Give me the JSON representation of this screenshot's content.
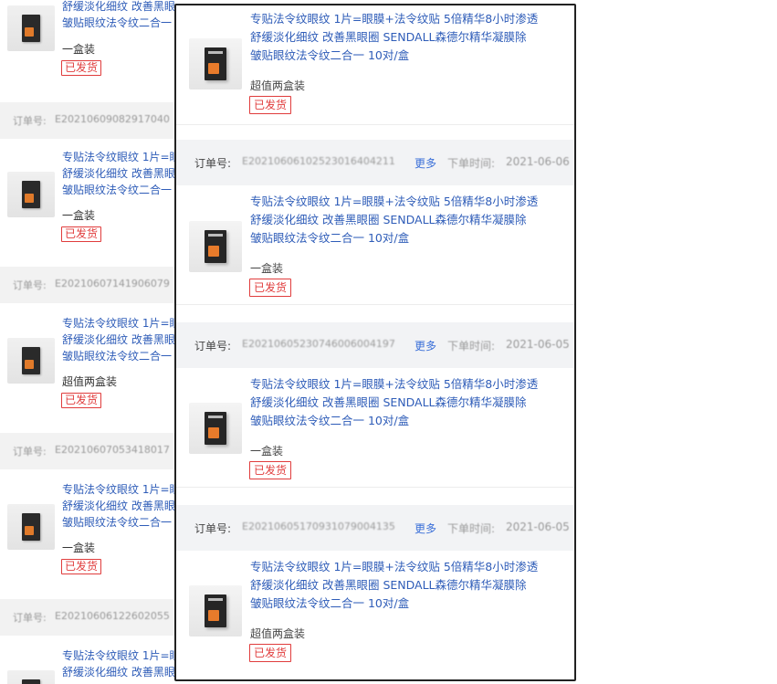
{
  "background_list": {
    "items": [
      {
        "title_lines": [
          "舒缓淡化细纹 改善黑眼",
          "皱贴眼纹法令纹二合一"
        ],
        "spec": "一盒装",
        "status": "已发货"
      },
      {
        "order_label": "订单号:",
        "order_no": "E20210609082917040"
      },
      {
        "title_lines": [
          "专贴法令纹眼纹 1片=眼",
          "舒缓淡化细纹 改善黑眼",
          "皱贴眼纹法令纹二合一"
        ],
        "spec": "一盒装",
        "status": "已发货"
      },
      {
        "order_label": "订单号:",
        "order_no": "E20210607141906079"
      },
      {
        "title_lines": [
          "专贴法令纹眼纹 1片=眼",
          "舒缓淡化细纹 改善黑眼",
          "皱贴眼纹法令纹二合一"
        ],
        "spec": "超值两盒装",
        "status": "已发货"
      },
      {
        "order_label": "订单号:",
        "order_no": "E20210607053418017"
      },
      {
        "title_lines": [
          "专贴法令纹眼纹 1片=眼",
          "舒缓淡化细纹 改善黑眼",
          "皱贴眼纹法令纹二合一"
        ],
        "spec": "一盒装",
        "status": "已发货"
      },
      {
        "order_label": "订单号:",
        "order_no": "E20210606122602055"
      },
      {
        "title_lines": [
          "专贴法令纹眼纹 1片=眼",
          "舒缓淡化细纹 改善黑眼"
        ]
      }
    ]
  },
  "panel": {
    "product_title_lines": [
      "专贴法令纹眼纹 1片=眼膜+法令纹贴 5倍精华8小时渗透",
      "舒缓淡化细纹 改善黑眼圈 SENDALL森德尔精华凝膜除",
      "皱贴眼纹法令纹二合一 10对/盒"
    ],
    "first_product": {
      "spec": "超值两盒装",
      "status": "已发货"
    },
    "orders": [
      {
        "label": "订单号:",
        "number": "E20210606102523016404211",
        "more": "更多",
        "time_label": "下单时间:",
        "time": "2021-06-06",
        "spec": "一盒装",
        "status": "已发货"
      },
      {
        "label": "订单号:",
        "number": "E20210605230746006004197",
        "more": "更多",
        "time_label": "下单时间:",
        "time": "2021-06-05",
        "spec": "一盒装",
        "status": "已发货"
      },
      {
        "label": "订单号:",
        "number": "E20210605170931079004135",
        "more": "更多",
        "time_label": "下单时间:",
        "time": "2021-06-05",
        "spec": "超值两盒装",
        "status": "已发货"
      }
    ]
  }
}
